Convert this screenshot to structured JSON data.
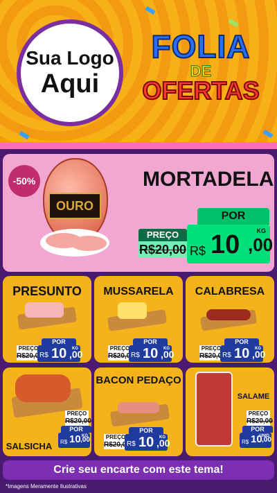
{
  "header": {
    "logo_line1": "Sua Logo",
    "logo_line2": "Aqui",
    "theme_line1": "FOLIA",
    "theme_line2": "DE",
    "theme_line3": "OFERTAS"
  },
  "hero": {
    "discount_badge": "-50%",
    "brand_label": "OURO",
    "title": "MORTADELA",
    "preco_label": "PREÇO",
    "old_price": "R$20,00",
    "por_label": "POR",
    "currency": "R$",
    "price_int": "10",
    "price_dec": ",00",
    "unit": "KG"
  },
  "items": [
    {
      "title": "PRESUNTO",
      "preco_label": "PREÇO",
      "old_price": "R$20,00",
      "por_label": "POR",
      "currency": "R$",
      "price_int": "10",
      "price_dec": ",00",
      "unit": "KG"
    },
    {
      "title": "MUSSARELA",
      "preco_label": "PREÇO",
      "old_price": "R$20,00",
      "por_label": "POR",
      "currency": "R$",
      "price_int": "10",
      "price_dec": ",00",
      "unit": "KG"
    },
    {
      "title": "CALABRESA",
      "preco_label": "PREÇO",
      "old_price": "R$20,00",
      "por_label": "POR",
      "currency": "R$",
      "price_int": "10",
      "price_dec": ",00",
      "unit": "KG"
    },
    {
      "title": "SALSICHA",
      "preco_label": "PREÇO",
      "old_price": "R$20,00",
      "por_label": "POR",
      "currency": "R$",
      "price_int": "10",
      "price_dec": ",00",
      "unit": "KG"
    },
    {
      "title": "BACON PEDAÇO",
      "preco_label": "PREÇO",
      "old_price": "R$20,00",
      "por_label": "POR",
      "currency": "R$",
      "price_int": "10",
      "price_dec": ",00",
      "unit": "KG"
    },
    {
      "title": "SALAME",
      "preco_label": "PREÇO",
      "old_price": "R$20,00",
      "por_label": "POR",
      "currency": "R$",
      "price_int": "10",
      "price_dec": ",00",
      "unit": "UNID"
    }
  ],
  "cta": "Crie seu encarte com este tema!",
  "footnote": "*Imagens Meramente Ilustrativas",
  "colors": {
    "accent": "#7c2fb0",
    "price_green": "#00e07a",
    "price_blue": "#1f3b9e",
    "card": "#f4b21b",
    "hero_bg": "#f1a7d2"
  }
}
